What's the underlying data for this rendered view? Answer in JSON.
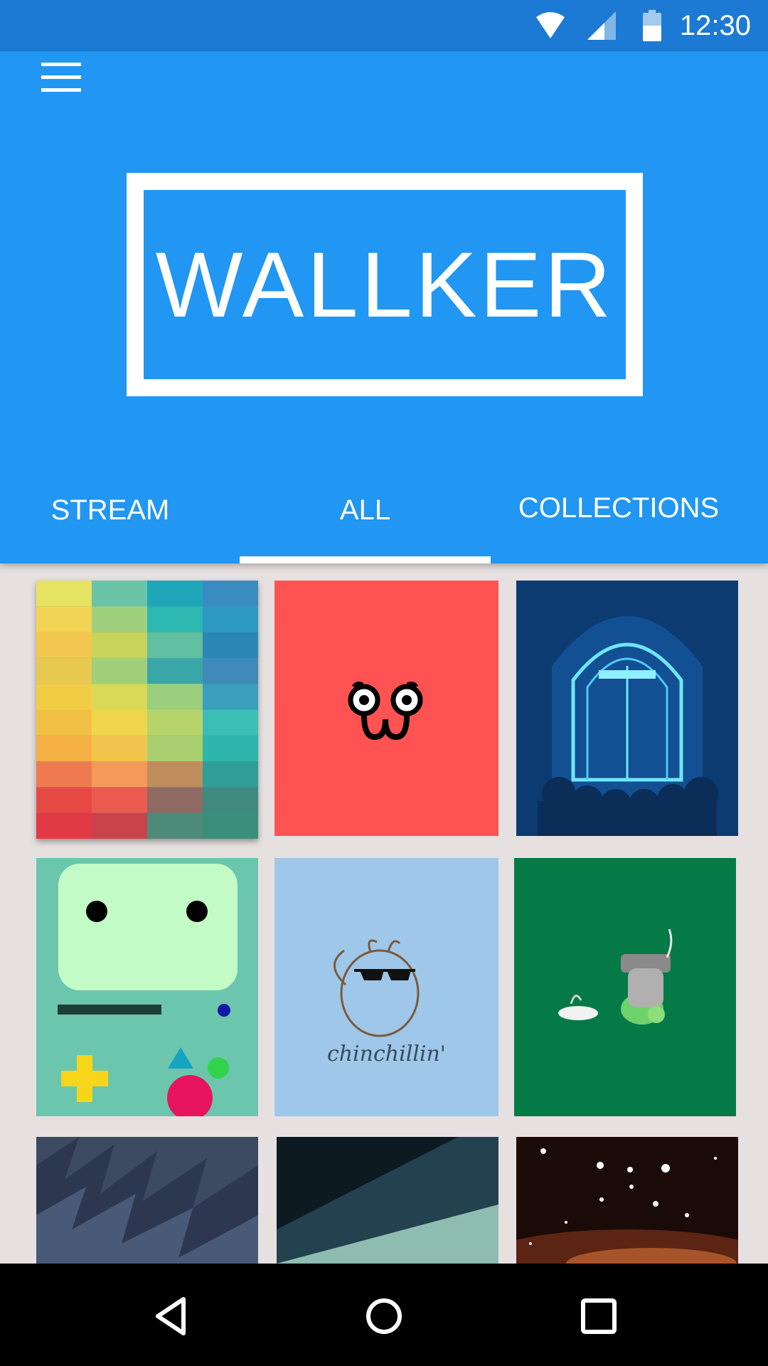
{
  "status_bar": {
    "time": "12:30",
    "icons": [
      "wifi-icon",
      "cellular-signal-icon",
      "battery-icon"
    ]
  },
  "header": {
    "menu_icon": "hamburger-menu-icon",
    "logo_text": "WALLKER",
    "tabs": [
      {
        "label": "STREAM",
        "active": false
      },
      {
        "label": "ALL",
        "active": true
      },
      {
        "label": "COLLECTIONS",
        "active": false
      }
    ],
    "color": "#2196f3"
  },
  "grid": {
    "tiles": [
      {
        "artwork": "pixel-gradient-wallpaper"
      },
      {
        "artwork": "cartoon-face-red-wallpaper"
      },
      {
        "artwork": "glowing-door-wallpaper"
      },
      {
        "artwork": "bmo-face-wallpaper"
      },
      {
        "artwork": "chinchilla-sunglasses-wallpaper",
        "caption": "chinchillin'"
      },
      {
        "artwork": "turtle-minigun-wallpaper"
      },
      {
        "artwork": "dark-feathers-wallpaper"
      },
      {
        "artwork": "geometric-rays-wallpaper"
      },
      {
        "artwork": "star-cluster-wallpaper"
      }
    ]
  },
  "nav_bar": {
    "icons": [
      "back-triangle-icon",
      "home-circle-icon",
      "recents-square-icon"
    ]
  }
}
